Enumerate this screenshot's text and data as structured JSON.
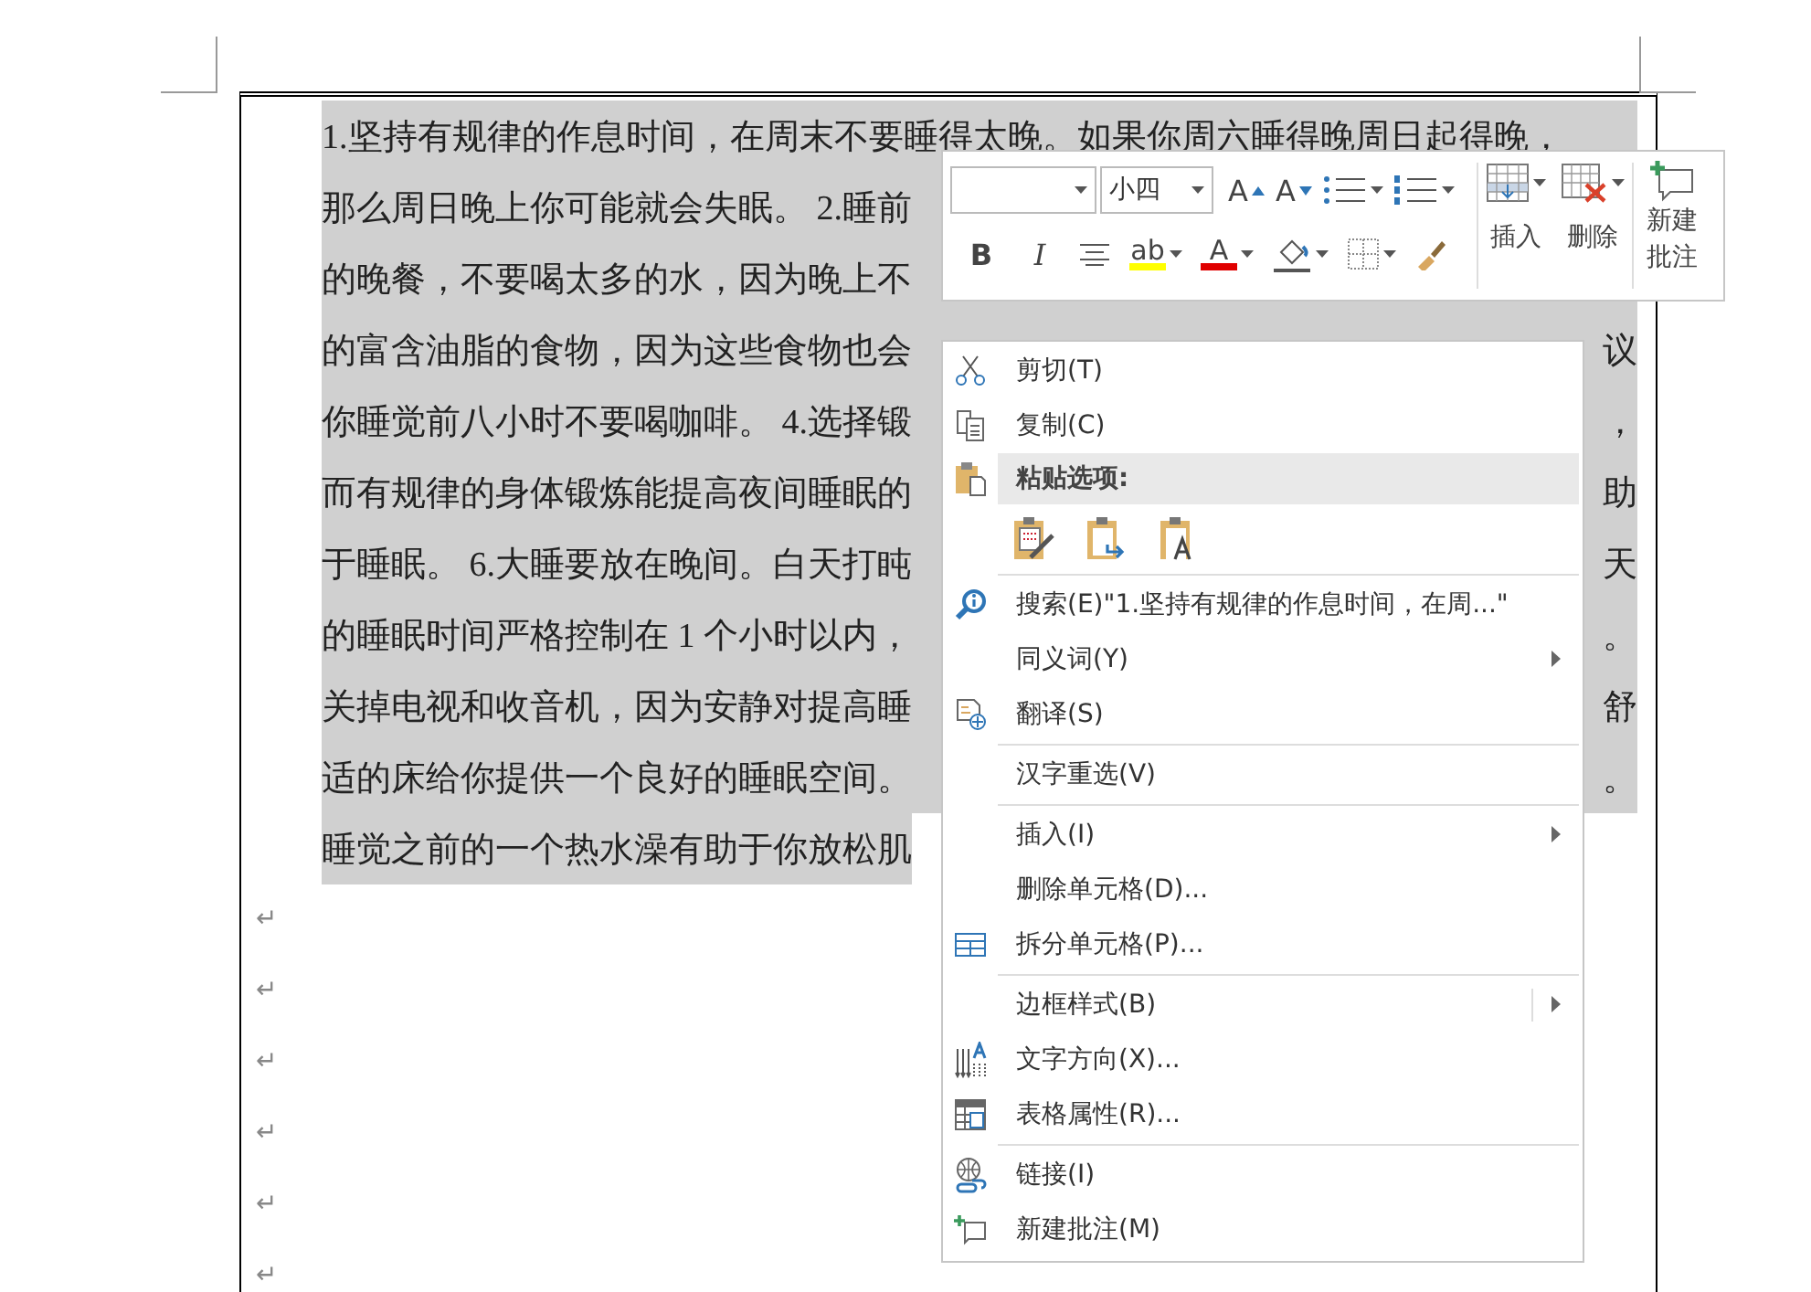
{
  "document": {
    "lines": [
      {
        "left": "1.坚持有规律的作息时间，在周末不要睡得太晚。如果你周六睡得晚周日起得晚，",
        "selected": true
      },
      {
        "left": "那么周日晚上你可能就会失眠。 2.睡前",
        "selected": true
      },
      {
        "left": "的晚餐，不要喝太多的水，因为晚上不",
        "selected": true
      },
      {
        "left": "的富含油脂的食物，因为这些食物也会",
        "right": "议",
        "selected": true
      },
      {
        "left": "你睡觉前八小时不要喝咖啡。 4.选择锻",
        "right": "，",
        "selected": true
      },
      {
        "left": "而有规律的身体锻炼能提高夜间睡眠的",
        "right": "助",
        "selected": true
      },
      {
        "left": "于睡眠。 6.大睡要放在晚间。白天打盹",
        "right": "天",
        "selected": true
      },
      {
        "left": "的睡眠时间严格控制在 1 个小时以内，",
        "right": "。",
        "selected": true
      },
      {
        "left": "关掉电视和收音机，因为安静对提高睡",
        "right": "舒",
        "selected": true
      },
      {
        "left": "适的床给你提供一个良好的睡眠空间。",
        "right": "。",
        "selected": true
      },
      {
        "left": "睡觉之前的一个热水澡有助于你放松肌",
        "selected": true
      }
    ],
    "paragraph_marks": [
      "↵",
      "↵",
      "↵",
      "↵",
      "↵",
      "↵"
    ]
  },
  "mini_toolbar": {
    "font_size": "小四",
    "rows": [
      [
        {
          "kind": "grow-font",
          "text": "A"
        },
        {
          "kind": "shrink-font",
          "text": "A"
        },
        {
          "kind": "bullets"
        },
        {
          "kind": "numbering"
        }
      ],
      [
        {
          "kind": "bold",
          "text": "B"
        },
        {
          "kind": "italic",
          "text": "I"
        },
        {
          "kind": "center"
        },
        {
          "kind": "highlight",
          "text": "ab",
          "color": "#ffff00"
        },
        {
          "kind": "font-color",
          "text": "A",
          "color": "#e00000"
        },
        {
          "kind": "shading"
        },
        {
          "kind": "borders"
        },
        {
          "kind": "format-painter"
        }
      ]
    ],
    "table_buttons": [
      {
        "kind": "insert",
        "label": "插入"
      },
      {
        "kind": "delete",
        "label": "删除"
      }
    ],
    "comment_button": {
      "label": "新建批注"
    }
  },
  "context_menu": {
    "groups": [
      [
        {
          "kind": "command",
          "label": "剪切(T)",
          "submenu": false
        },
        {
          "kind": "command",
          "label": "复制(C)",
          "submenu": false
        },
        {
          "kind": "header",
          "label": "粘贴选项:"
        },
        {
          "kind": "paste-options"
        }
      ],
      [
        {
          "kind": "command",
          "label": "搜索(E)\"1.坚持有规律的作息时间，在周...\"",
          "submenu": false
        },
        {
          "kind": "command",
          "label": "同义词(Y)",
          "submenu": true
        },
        {
          "kind": "command",
          "label": "翻译(S)",
          "submenu": false
        }
      ],
      [
        {
          "kind": "command",
          "label": "汉字重选(V)",
          "submenu": false
        }
      ],
      [
        {
          "kind": "command",
          "label": "插入(I)",
          "submenu": true
        },
        {
          "kind": "command",
          "label": "删除单元格(D)...",
          "submenu": false
        },
        {
          "kind": "command",
          "label": "拆分单元格(P)...",
          "submenu": false
        }
      ],
      [
        {
          "kind": "command",
          "label": "边框样式(B)",
          "submenu": true
        },
        {
          "kind": "command",
          "label": "文字方向(X)...",
          "submenu": false
        },
        {
          "kind": "command",
          "label": "表格属性(R)...",
          "submenu": false
        }
      ],
      [
        {
          "kind": "command",
          "label": "链接(I)",
          "submenu": false
        },
        {
          "kind": "command",
          "label": "新建批注(M)",
          "submenu": false
        }
      ]
    ]
  }
}
